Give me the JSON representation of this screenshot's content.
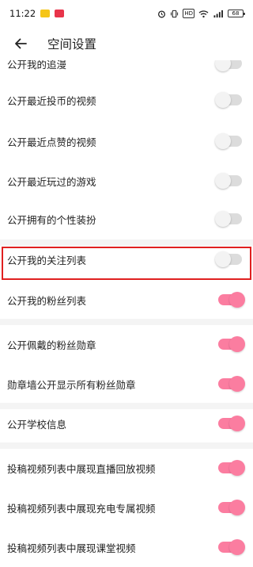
{
  "status_bar": {
    "time": "11:22",
    "battery": "68",
    "hd_label": "HD",
    "icons": [
      "alarm-icon",
      "vibrate-icon",
      "hd-icon",
      "wifi-icon",
      "signal-icon",
      "battery-icon"
    ]
  },
  "header": {
    "back_icon": "arrow-left-icon",
    "title": "空间设置"
  },
  "settings": [
    {
      "label": "公开我的追漫",
      "state": "off"
    },
    {
      "label": "公开最近投币的视频",
      "state": "off"
    },
    {
      "label": "公开最近点赞的视频",
      "state": "off"
    },
    {
      "label": "公开最近玩过的游戏",
      "state": "off"
    },
    {
      "label": "公开拥有的个性装扮",
      "state": "off"
    },
    {
      "label": "公开我的关注列表",
      "state": "off",
      "highlighted": true
    },
    {
      "label": "公开我的粉丝列表",
      "state": "on"
    },
    {
      "label": "公开佩戴的粉丝勋章",
      "state": "on"
    },
    {
      "label": "勋章墙公开显示所有粉丝勋章",
      "state": "on"
    },
    {
      "label": "公开学校信息",
      "state": "on"
    },
    {
      "label": "投稿视频列表中展现直播回放视频",
      "state": "on"
    },
    {
      "label": "投稿视频列表中展现充电专属视频",
      "state": "on"
    },
    {
      "label": "投稿视频列表中展现课堂视频",
      "state": "on"
    }
  ],
  "colors": {
    "toggle_on": "#fb7299",
    "toggle_off": "#dcdcdc",
    "highlight": "#e02020"
  }
}
